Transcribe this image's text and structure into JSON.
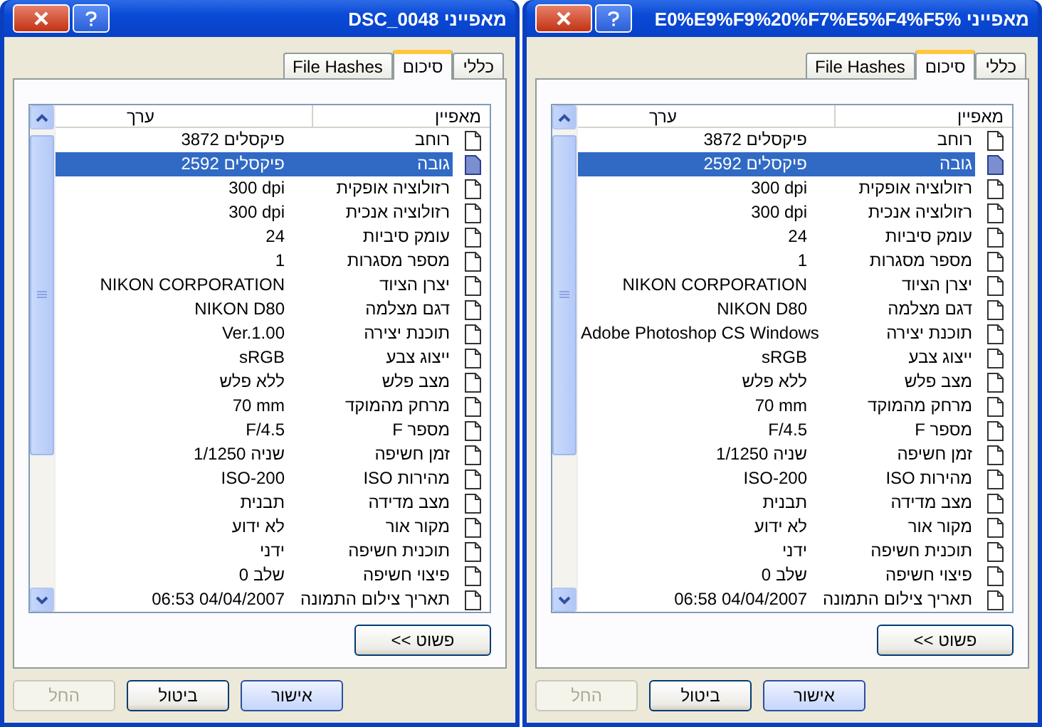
{
  "dialogs": [
    {
      "title": "מאפייני %E0%E9%F9%20%F7%E5%F4%F5",
      "tabs": [
        {
          "label": "כללי",
          "selected": false
        },
        {
          "label": "סיכום",
          "selected": true
        },
        {
          "label": "File Hashes",
          "selected": false
        }
      ],
      "columns": [
        "מאפיין",
        "ערך"
      ],
      "rows": [
        {
          "property": "רוחב",
          "value": "3872 פיקסלים",
          "selected": false
        },
        {
          "property": "גובה",
          "value": "2592 פיקסלים",
          "selected": true
        },
        {
          "property": "רזולוציה אופקית",
          "value": "300 dpi",
          "selected": false
        },
        {
          "property": "רזולוציה אנכית",
          "value": "300 dpi",
          "selected": false
        },
        {
          "property": "עומק סיביות",
          "value": "24",
          "selected": false
        },
        {
          "property": "מספר מסגרות",
          "value": "1",
          "selected": false
        },
        {
          "property": "יצרן הציוד",
          "value": "NIKON CORPORATION",
          "selected": false
        },
        {
          "property": "דגם מצלמה",
          "value": "NIKON D80",
          "selected": false
        },
        {
          "property": "תוכנת יצירה",
          "value": "Adobe Photoshop CS Windows",
          "selected": false
        },
        {
          "property": "ייצוג צבע",
          "value": "sRGB",
          "selected": false
        },
        {
          "property": "מצב פלש",
          "value": "ללא פלש",
          "selected": false
        },
        {
          "property": "מרחק מהמוקד",
          "value": "70 mm",
          "selected": false
        },
        {
          "property": "מספר F",
          "value": "F/4.5",
          "selected": false
        },
        {
          "property": "זמן חשיפה",
          "value": "1/1250 שניה",
          "selected": false
        },
        {
          "property": "מהירות ISO",
          "value": "ISO-200",
          "selected": false
        },
        {
          "property": "מצב מדידה",
          "value": "תבנית",
          "selected": false
        },
        {
          "property": "מקור אור",
          "value": "לא ידוע",
          "selected": false
        },
        {
          "property": "תוכנית חשיפה",
          "value": "ידני",
          "selected": false
        },
        {
          "property": "פיצוי חשיפה",
          "value": "שלב 0",
          "selected": false
        },
        {
          "property": "תאריך צילום התמונה",
          "value": "06:58 04/04/2007",
          "selected": false
        }
      ],
      "toggle_button": "פשוט >>",
      "buttons": [
        {
          "label": "אישור",
          "kind": "default",
          "disabled": false
        },
        {
          "label": "ביטול",
          "kind": "normal",
          "disabled": false
        },
        {
          "label": "החל",
          "kind": "normal",
          "disabled": true
        }
      ]
    },
    {
      "title": "מאפייני DSC_0048",
      "tabs": [
        {
          "label": "כללי",
          "selected": false
        },
        {
          "label": "סיכום",
          "selected": true
        },
        {
          "label": "File Hashes",
          "selected": false
        }
      ],
      "columns": [
        "מאפיין",
        "ערך"
      ],
      "rows": [
        {
          "property": "רוחב",
          "value": "3872 פיקסלים",
          "selected": false
        },
        {
          "property": "גובה",
          "value": "2592 פיקסלים",
          "selected": true
        },
        {
          "property": "רזולוציה אופקית",
          "value": "300 dpi",
          "selected": false
        },
        {
          "property": "רזולוציה אנכית",
          "value": "300 dpi",
          "selected": false
        },
        {
          "property": "עומק סיביות",
          "value": "24",
          "selected": false
        },
        {
          "property": "מספר מסגרות",
          "value": "1",
          "selected": false
        },
        {
          "property": "יצרן הציוד",
          "value": "NIKON CORPORATION",
          "selected": false
        },
        {
          "property": "דגם מצלמה",
          "value": "NIKON D80",
          "selected": false
        },
        {
          "property": "תוכנת יצירה",
          "value": "Ver.1.00",
          "selected": false
        },
        {
          "property": "ייצוג צבע",
          "value": "sRGB",
          "selected": false
        },
        {
          "property": "מצב פלש",
          "value": "ללא פלש",
          "selected": false
        },
        {
          "property": "מרחק מהמוקד",
          "value": "70 mm",
          "selected": false
        },
        {
          "property": "מספר F",
          "value": "F/4.5",
          "selected": false
        },
        {
          "property": "זמן חשיפה",
          "value": "1/1250 שניה",
          "selected": false
        },
        {
          "property": "מהירות ISO",
          "value": "ISO-200",
          "selected": false
        },
        {
          "property": "מצב מדידה",
          "value": "תבנית",
          "selected": false
        },
        {
          "property": "מקור אור",
          "value": "לא ידוע",
          "selected": false
        },
        {
          "property": "תוכנית חשיפה",
          "value": "ידני",
          "selected": false
        },
        {
          "property": "פיצוי חשיפה",
          "value": "שלב 0",
          "selected": false
        },
        {
          "property": "תאריך צילום התמונה",
          "value": "06:53 04/04/2007",
          "selected": false
        }
      ],
      "toggle_button": "פשוט >>",
      "buttons": [
        {
          "label": "אישור",
          "kind": "default",
          "disabled": false
        },
        {
          "label": "ביטול",
          "kind": "normal",
          "disabled": false
        },
        {
          "label": "החל",
          "kind": "normal",
          "disabled": true
        }
      ]
    }
  ]
}
